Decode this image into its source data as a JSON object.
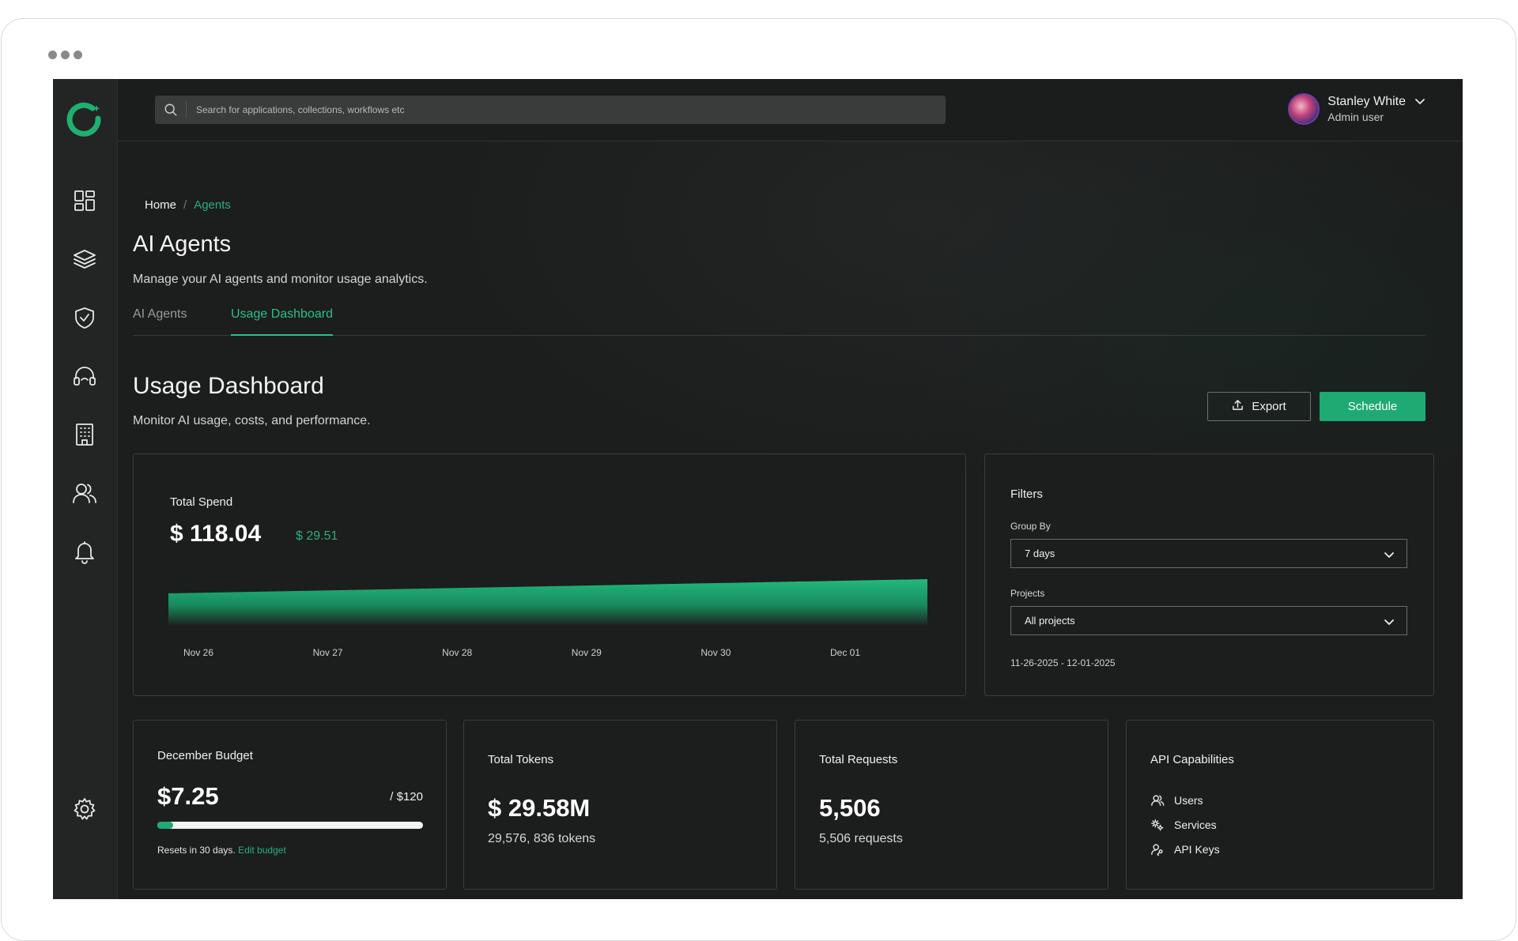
{
  "topbar": {
    "search_placeholder": "Search for applications, collections, workflows etc",
    "user_name": "Stanley White",
    "user_role": "Admin user"
  },
  "sidebar": {
    "items": [
      {
        "icon": "dashboard-icon"
      },
      {
        "icon": "layers-icon"
      },
      {
        "icon": "shield-check-icon"
      },
      {
        "icon": "headset-icon"
      },
      {
        "icon": "building-icon"
      },
      {
        "icon": "users-icon"
      },
      {
        "icon": "bell-icon"
      },
      {
        "icon": "settings-icon"
      }
    ]
  },
  "breadcrumb": {
    "home": "Home",
    "separator": "/",
    "current": "Agents"
  },
  "page": {
    "title": "AI Agents",
    "subtitle": "Manage your AI agents and monitor usage analytics.",
    "tabs": [
      {
        "label": "AI Agents",
        "active": false
      },
      {
        "label": "Usage Dashboard",
        "active": true
      }
    ]
  },
  "dashboard": {
    "title": "Usage Dashboard",
    "subtitle": "Monitor AI usage, costs, and performance.",
    "export_label": "Export",
    "schedule_label": "Schedule"
  },
  "spend": {
    "label": "Total Spend",
    "value": "$ 118.04",
    "delta": "$ 29.51"
  },
  "chart_data": {
    "type": "area",
    "x": [
      "Nov 26",
      "Nov 27",
      "Nov 28",
      "Nov 29",
      "Nov 30",
      "Dec 01"
    ],
    "title": "",
    "xlabel": "",
    "ylabel": "",
    "grid": false,
    "color": "#1faa73"
  },
  "filters": {
    "title": "Filters",
    "group_by_label": "Group By",
    "group_by_value": "7 days",
    "projects_label": "Projects",
    "projects_value": "All projects",
    "date_range": "11-26-2025 - 12-01-2025"
  },
  "budget": {
    "label": "December Budget",
    "value": "$7.25",
    "max": "/ $120",
    "progress_fraction": 0.0604,
    "reset_text": "Resets in 30 days.",
    "edit_label": "Edit budget"
  },
  "tokens": {
    "label": "Total Tokens",
    "value": "$ 29.58M",
    "sub": "29,576, 836 tokens"
  },
  "requests": {
    "label": "Total Requests",
    "value": "5,506",
    "sub": "5,506 requests"
  },
  "capabilities": {
    "label": "API Capabilities",
    "items": [
      {
        "label": "Users",
        "icon": "users-icon"
      },
      {
        "label": "Services",
        "icon": "gears-icon"
      },
      {
        "label": "API Keys",
        "icon": "api-key-icon"
      }
    ]
  },
  "colors": {
    "accent": "#1faa73",
    "background": "#1c1d1d",
    "sidebar": "#232424"
  }
}
